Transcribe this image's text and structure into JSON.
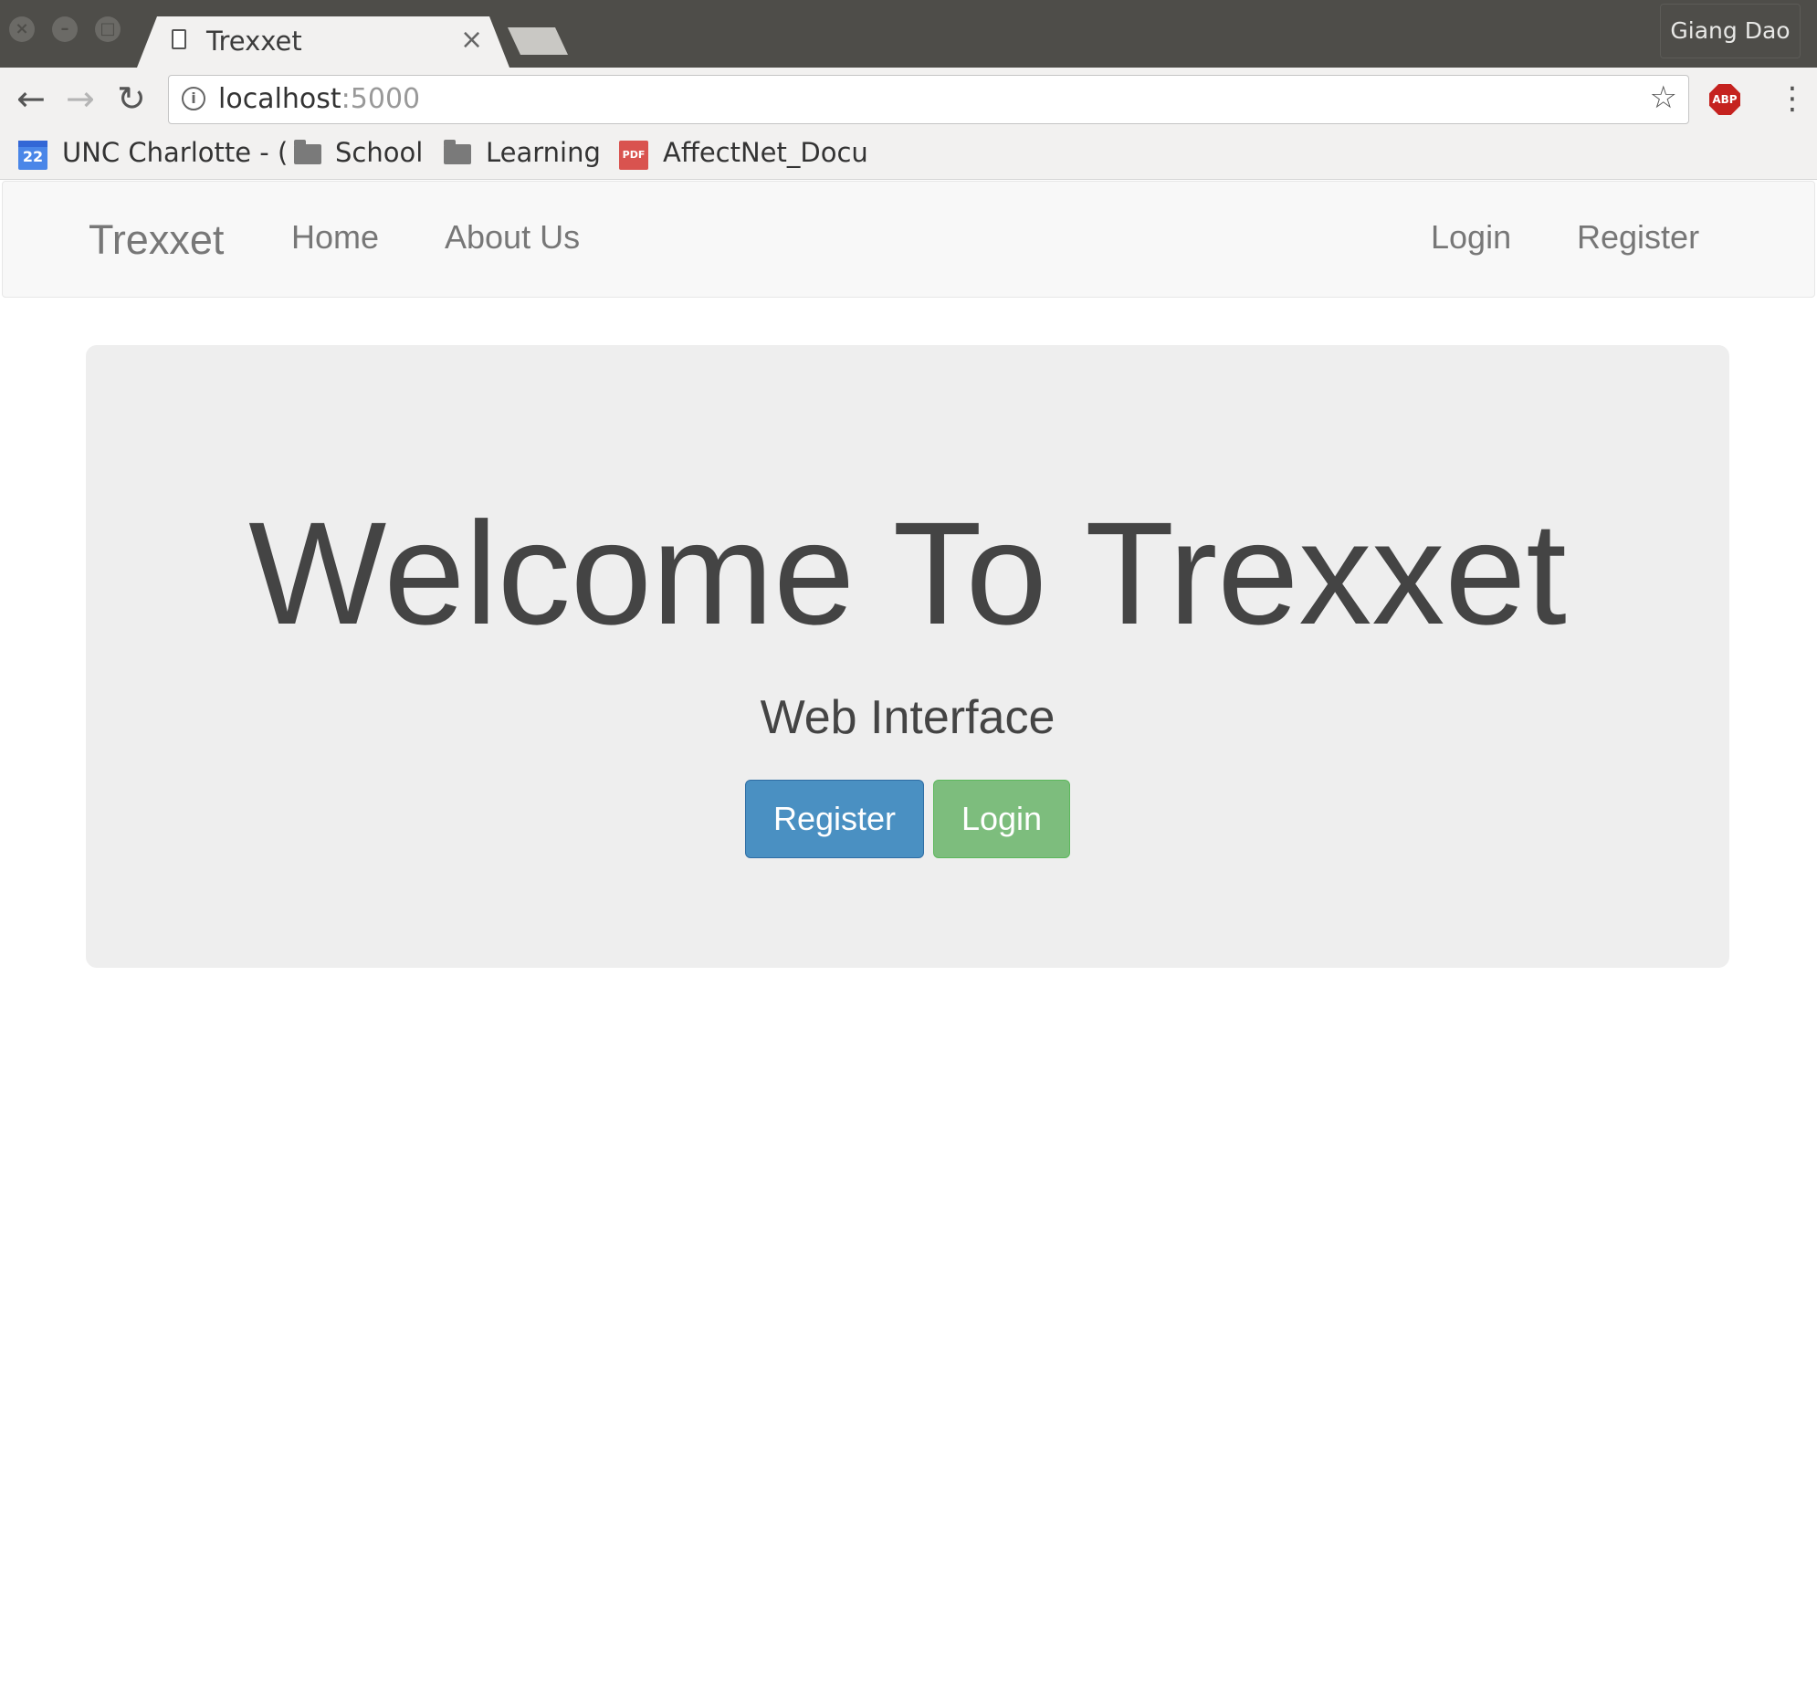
{
  "browser": {
    "tab_title": "Trexxet",
    "tab_close": "×",
    "profile_name": "Giang Dao",
    "url_host": "localhost",
    "url_port": ":5000",
    "bookmarks": [
      {
        "label": "UNC Charlotte - (",
        "icon": "calendar-icon",
        "icon_text": "22"
      },
      {
        "label": "School",
        "icon": "folder-icon"
      },
      {
        "label": "Learning",
        "icon": "folder-icon"
      },
      {
        "label": "AffectNet_Docu",
        "icon": "pdf-icon",
        "icon_text": "PDF"
      }
    ],
    "extension_label": "ABP"
  },
  "navbar": {
    "brand": "Trexxet",
    "links": [
      "Home",
      "About Us"
    ],
    "right_links": [
      "Login",
      "Register"
    ]
  },
  "jumbotron": {
    "title": "Welcome To Trexxet",
    "subtitle": "Web Interface",
    "register_button": "Register",
    "login_button": "Login"
  },
  "colors": {
    "register_button": "#4a90c2",
    "login_button": "#7dbd7d",
    "jumbotron_bg": "#eeeeee",
    "titlebar": "#4e4d49"
  }
}
